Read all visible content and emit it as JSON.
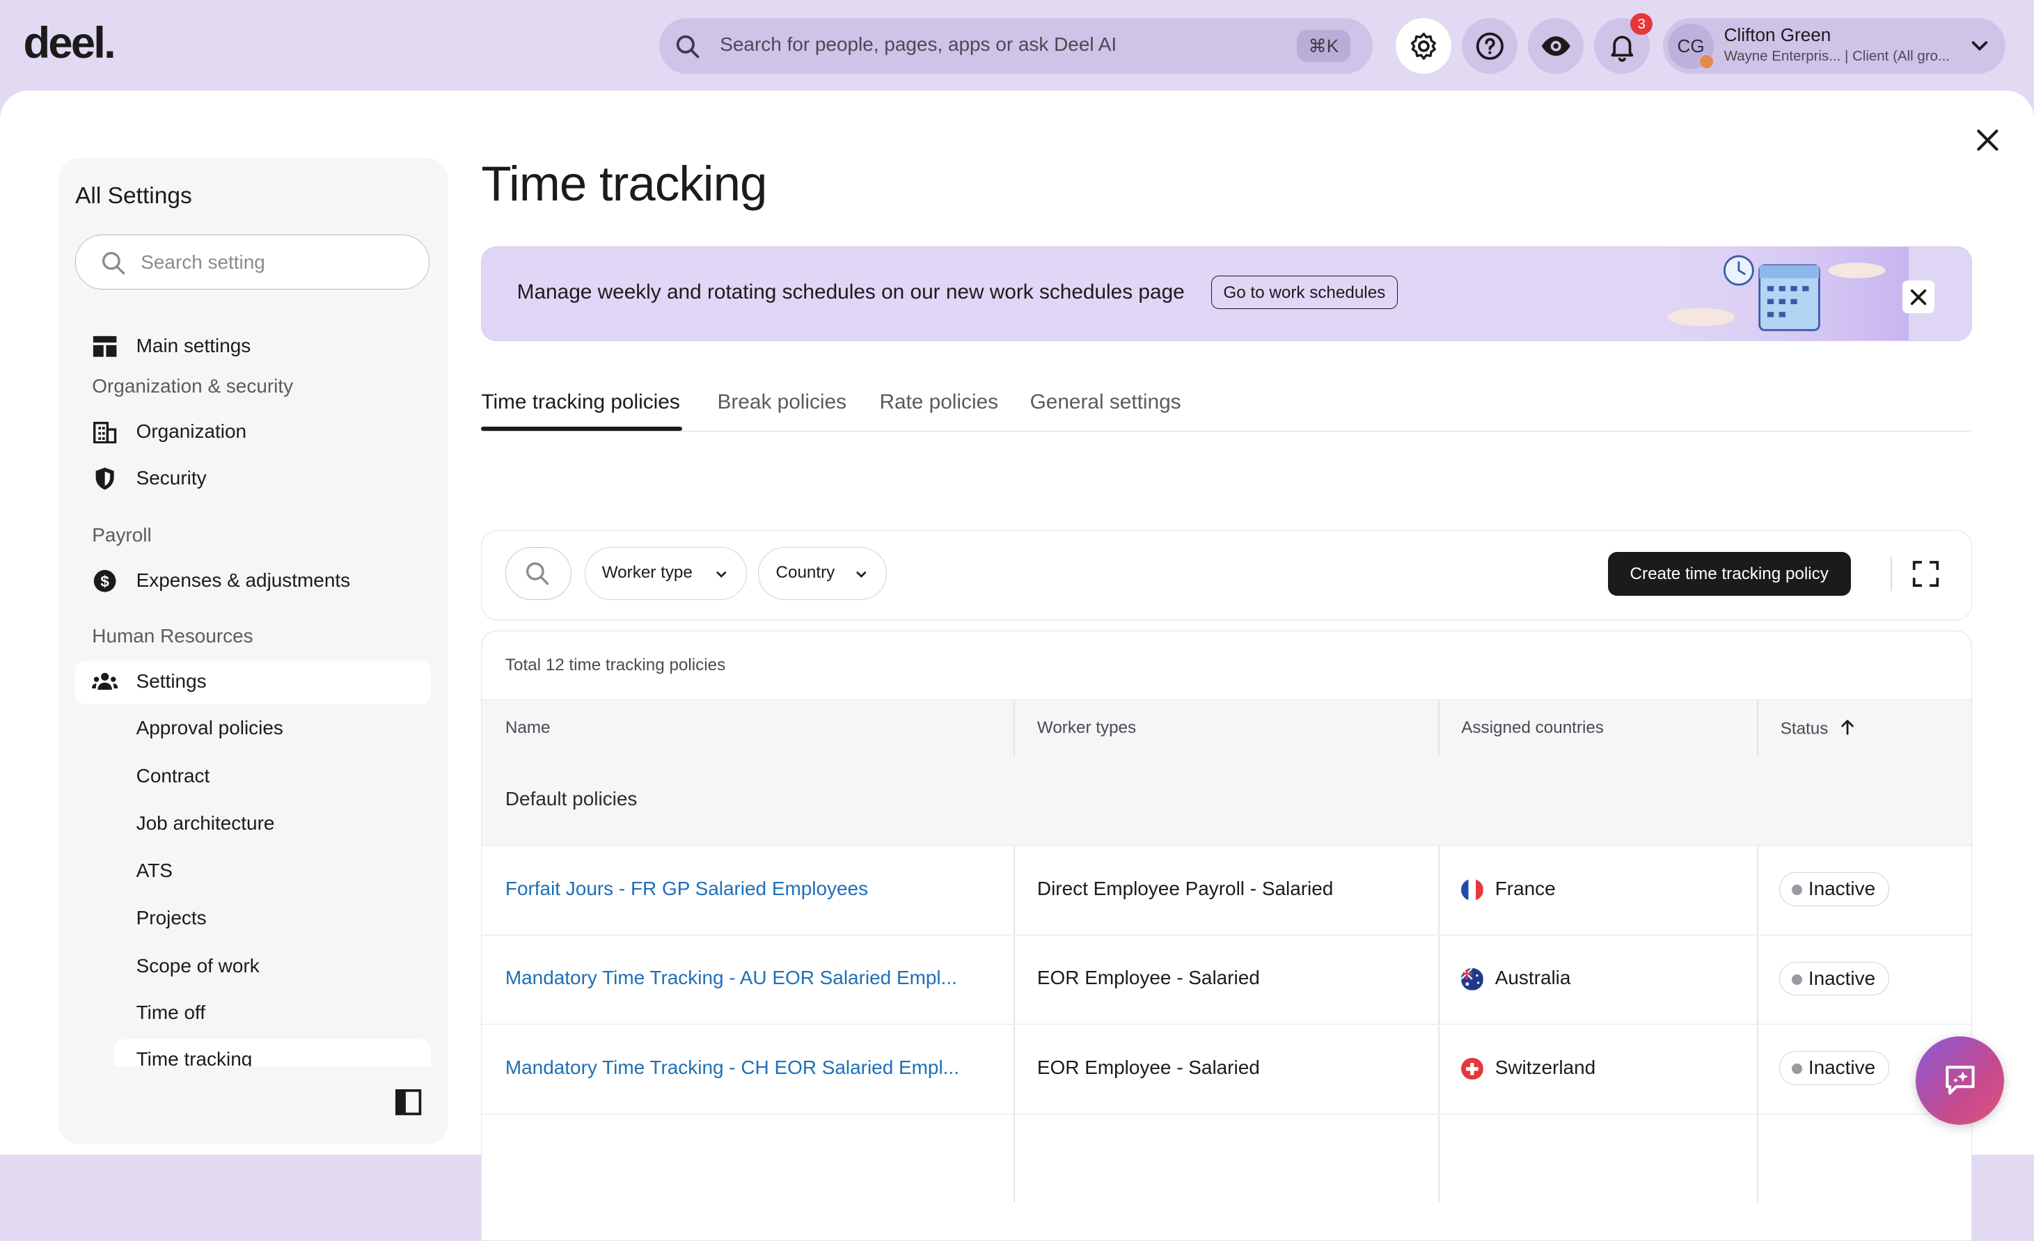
{
  "app": {
    "logo": "deel."
  },
  "topbar": {
    "search_placeholder": "Search for people, pages, apps or ask Deel AI",
    "search_shortcut": "⌘K",
    "notifications_count": "3",
    "user": {
      "initials": "CG",
      "name": "Clifton Green",
      "org": "Wayne Enterpris... | Client (All gro..."
    }
  },
  "sidebar": {
    "title": "All Settings",
    "search_placeholder": "Search setting",
    "main_settings": "Main settings",
    "sections": [
      {
        "label": "Organization & security"
      },
      {
        "label": "Payroll"
      },
      {
        "label": "Human Resources"
      }
    ],
    "items": {
      "organization": "Organization",
      "security": "Security",
      "expenses": "Expenses & adjustments",
      "settings": "Settings"
    },
    "sub_items": [
      "Approval policies",
      "Contract",
      "Job architecture",
      "ATS",
      "Projects",
      "Scope of work",
      "Time off",
      "Time tracking"
    ]
  },
  "page": {
    "title": "Time tracking",
    "banner": {
      "text": "Manage weekly and rotating schedules on our new work schedules page",
      "button": "Go to work schedules"
    },
    "tabs": [
      "Time tracking policies",
      "Break policies",
      "Rate policies",
      "General settings"
    ],
    "active_tab": "Time tracking policies",
    "filters": {
      "worker_type": "Worker type",
      "country": "Country"
    },
    "create_button": "Create time tracking policy",
    "table": {
      "total": "Total 12 time tracking policies",
      "columns": [
        "Name",
        "Worker types",
        "Assigned countries",
        "Status"
      ],
      "group": "Default policies",
      "rows": [
        {
          "name": "Forfait Jours - FR GP Salaried Employees",
          "worker_type": "Direct Employee Payroll - Salaried",
          "country": "France",
          "status": "Inactive"
        },
        {
          "name": "Mandatory Time Tracking - AU EOR Salaried Empl...",
          "worker_type": "EOR Employee - Salaried",
          "country": "Australia",
          "status": "Inactive"
        },
        {
          "name": "Mandatory Time Tracking - CH EOR Salaried Empl...",
          "worker_type": "EOR Employee - Salaried",
          "country": "Switzerland",
          "status": "Inactive"
        }
      ]
    }
  },
  "colors": {
    "accent": "#e2d9f3",
    "link": "#1f6fb8",
    "primary_button": "#1b1b1b",
    "badge": "#e5383b"
  }
}
